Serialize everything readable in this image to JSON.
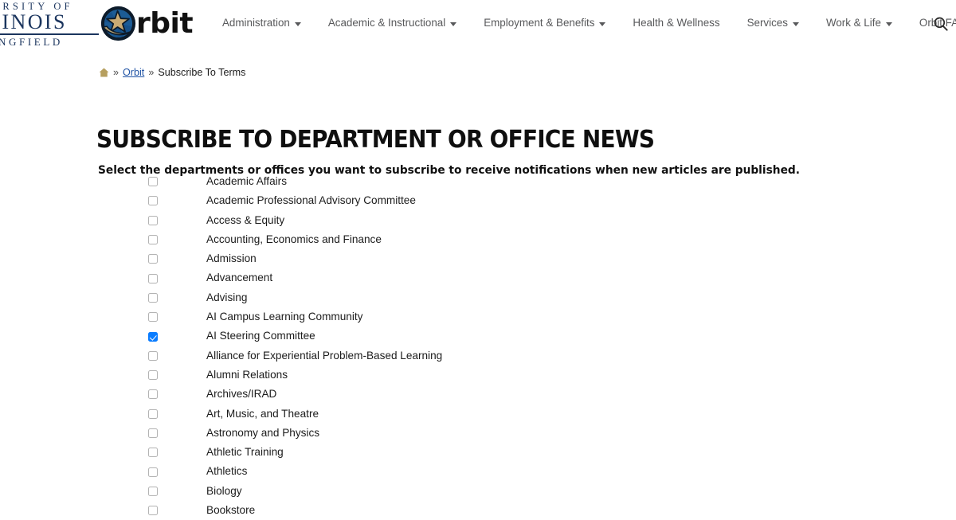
{
  "header": {
    "university_logo": {
      "line1": "VERSITY OF",
      "line2": "LINOIS",
      "line3": "INGFIELD"
    },
    "brand": {
      "wordmark": "rbit",
      "mark_icon": "orbit-star-globe-icon",
      "colors": {
        "globe_blue": "#1c5c96",
        "globe_dark": "#0d1b2a",
        "star_gold": "#c9ab74",
        "ring_tan": "#b6a173"
      }
    },
    "nav": [
      {
        "label": "Administration",
        "has_dropdown": true
      },
      {
        "label": "Academic & Instructional",
        "has_dropdown": true
      },
      {
        "label": "Employment & Benefits",
        "has_dropdown": true
      },
      {
        "label": "Health & Wellness",
        "has_dropdown": false
      },
      {
        "label": "Services",
        "has_dropdown": true
      },
      {
        "label": "Work & Life",
        "has_dropdown": true
      },
      {
        "label": "Orbit FAQs",
        "has_dropdown": false
      }
    ],
    "search_icon": "search-icon"
  },
  "breadcrumb": {
    "home_icon": "home-icon",
    "separator": "»",
    "link_label": "Orbit",
    "current_label": "Subscribe To Terms"
  },
  "main": {
    "title": "SUBSCRIBE TO DEPARTMENT OR OFFICE NEWS",
    "subtitle": "Select the departments or offices you want to subscribe to receive notifications when new articles are published.",
    "accent_color": "#0a7cff",
    "departments": [
      {
        "label": "Academic Affairs",
        "checked": false
      },
      {
        "label": "Academic Professional Advisory Committee",
        "checked": false
      },
      {
        "label": "Access & Equity",
        "checked": false
      },
      {
        "label": "Accounting, Economics and Finance",
        "checked": false
      },
      {
        "label": "Admission",
        "checked": false
      },
      {
        "label": "Advancement",
        "checked": false
      },
      {
        "label": "Advising",
        "checked": false
      },
      {
        "label": "AI Campus Learning Community",
        "checked": false
      },
      {
        "label": "AI Steering Committee",
        "checked": true
      },
      {
        "label": "Alliance for Experiential Problem-Based Learning",
        "checked": false
      },
      {
        "label": "Alumni Relations",
        "checked": false
      },
      {
        "label": "Archives/IRAD",
        "checked": false
      },
      {
        "label": "Art, Music, and Theatre",
        "checked": false
      },
      {
        "label": "Astronomy and Physics",
        "checked": false
      },
      {
        "label": "Athletic Training",
        "checked": false
      },
      {
        "label": "Athletics",
        "checked": false
      },
      {
        "label": "Biology",
        "checked": false
      },
      {
        "label": "Bookstore",
        "checked": false
      }
    ]
  }
}
